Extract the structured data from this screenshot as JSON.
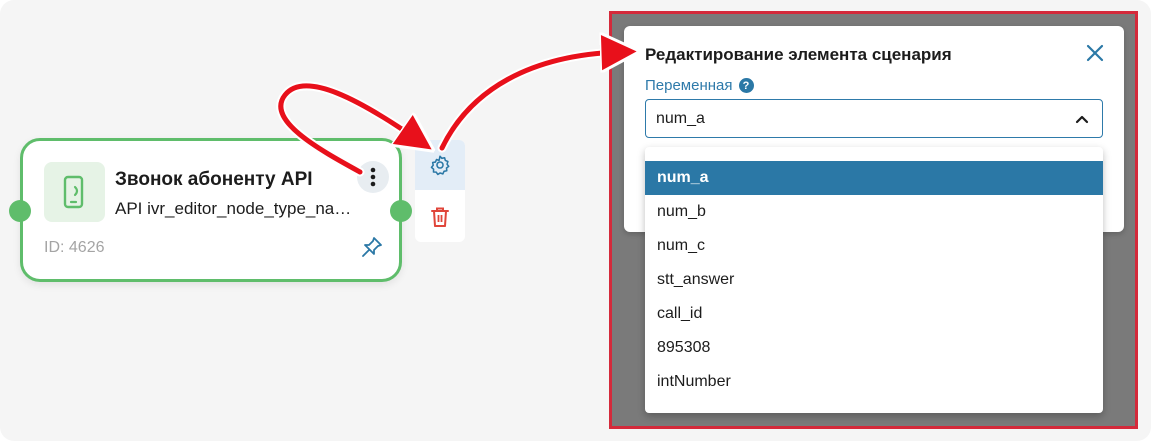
{
  "node": {
    "title": "Звонок абоненту API",
    "subtitle": "API ivr_editor_node_type_name",
    "id_label": "ID: 4626"
  },
  "icons": {
    "node": "phone-call-icon",
    "menu": "more-vertical-icon",
    "pin": "pin-icon",
    "settings": "gear-icon",
    "delete": "trash-icon",
    "close": "close-icon",
    "help": "help-icon",
    "caret": "chevron-up-icon"
  },
  "modal": {
    "title": "Редактирование элемента сценария",
    "field_label": "Переменная",
    "help_glyph": "?",
    "selected_value": "num_a"
  },
  "dropdown": {
    "options": [
      "num_a",
      "num_b",
      "num_c",
      "stt_answer",
      "call_id",
      "895308",
      "intNumber"
    ],
    "selected_index": 0
  },
  "colors": {
    "node_border": "#5fbd6b",
    "accent": "#2b78a6",
    "delete": "#e0453a",
    "highlight_frame": "#d42a3b"
  }
}
